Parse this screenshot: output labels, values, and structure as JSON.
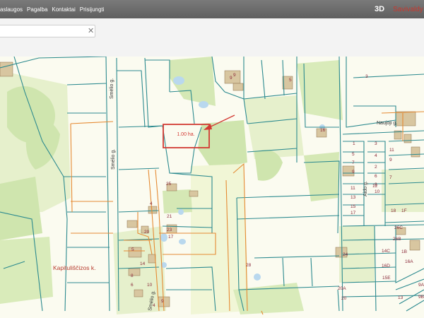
{
  "top_nav": {
    "items": [
      "aslaugos",
      "Pagalba",
      "Kontaktai",
      "Prisijungti"
    ],
    "mode_3d": "3D",
    "brand": "Savivaldy"
  },
  "search": {
    "value": "",
    "clear_icon": "close-icon"
  },
  "map": {
    "roads": {
      "smelio": "Smėlio g.",
      "naujoji": "Naujoji g.",
      "aido": "Aido g."
    },
    "village": "Kapituliščizos k.",
    "highlight_label": "1.00 ha.",
    "parcels": [
      "9",
      "5",
      "3",
      "16",
      "1",
      "3",
      "4",
      "5",
      "7",
      "9",
      "11",
      "13",
      "15",
      "17",
      "2",
      "6",
      "8",
      "10",
      "12",
      "11",
      "9",
      "7",
      "18",
      "1F",
      "26C",
      "26B",
      "14C",
      "1B",
      "16D",
      "16A",
      "15E",
      "13",
      "9A",
      "9B",
      "24",
      "20A",
      "20",
      "28",
      "25",
      "4",
      "21",
      "23",
      "20",
      "17",
      "5",
      "14",
      "8",
      "6",
      "9",
      "10",
      "4",
      "9"
    ],
    "colors": {
      "parcel": "#2c8a8f",
      "orange": "#e58a33",
      "highlight": "#d33a33",
      "green": "#cfe5ae",
      "lightgreen": "#e8f2cf",
      "building": "#d8c6a0",
      "water": "#b9d8ee"
    }
  }
}
